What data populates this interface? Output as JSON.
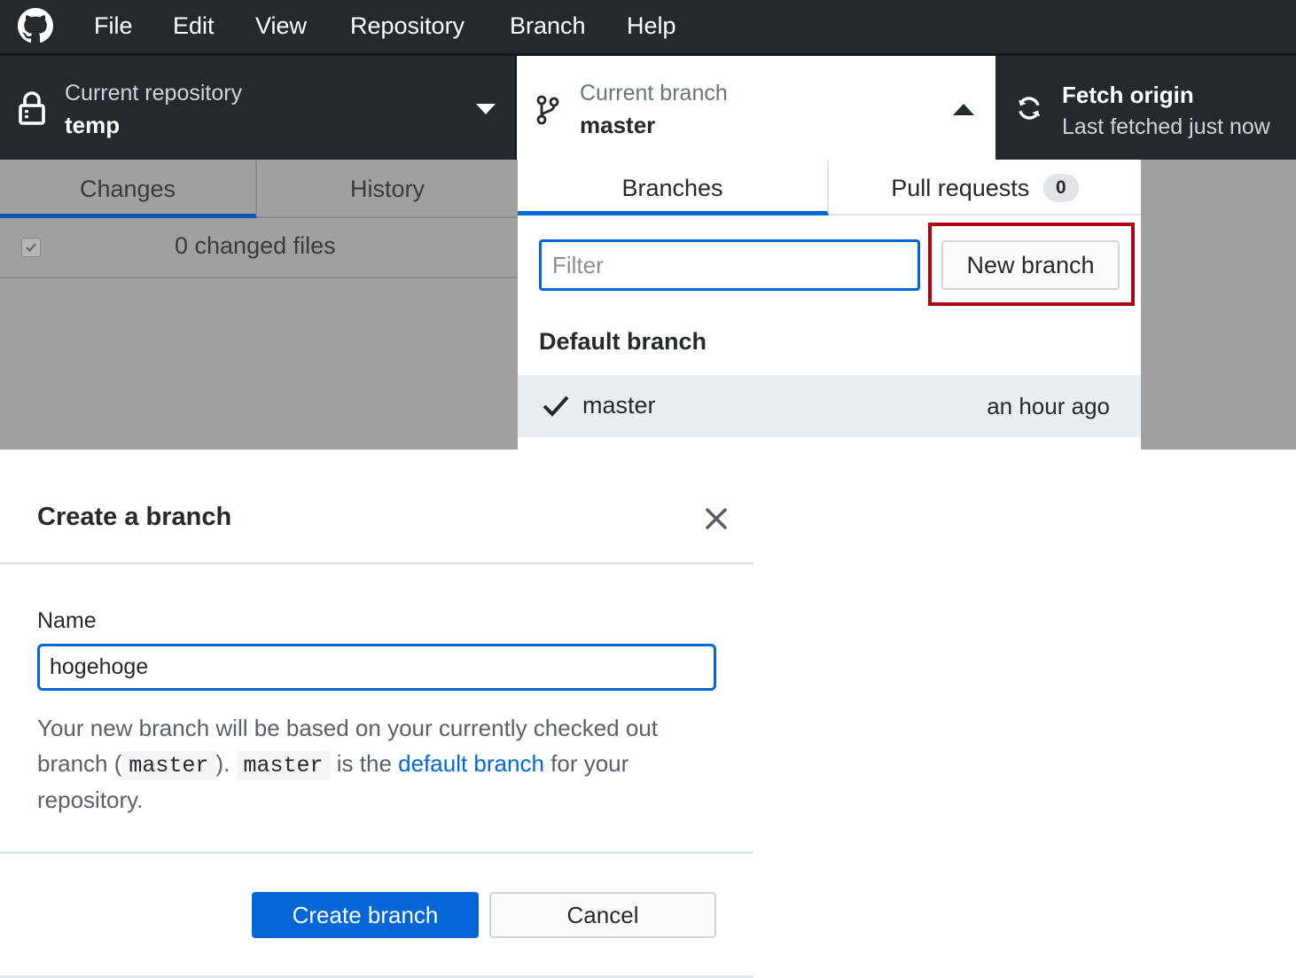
{
  "menubar": {
    "logo_icon": "github-logo-icon",
    "items": [
      "File",
      "Edit",
      "View",
      "Repository",
      "Branch",
      "Help"
    ]
  },
  "toolbar": {
    "repository": {
      "label": "Current repository",
      "value": "temp",
      "icon": "lock-icon"
    },
    "branch": {
      "label": "Current branch",
      "value": "master",
      "icon": "git-branch-icon"
    },
    "fetch": {
      "label": "Fetch origin",
      "subtitle": "Last fetched just now",
      "icon": "sync-icon"
    }
  },
  "left_panel": {
    "tabs": [
      "Changes",
      "History"
    ],
    "active_tab": "Changes",
    "changed_files": "0 changed files"
  },
  "branch_dropdown": {
    "tabs": {
      "branches": "Branches",
      "pull_requests": "Pull requests",
      "pull_request_count": "0"
    },
    "filter": {
      "placeholder": "Filter",
      "value": ""
    },
    "new_branch_label": "New branch",
    "section_title": "Default branch",
    "branches": [
      {
        "name": "master",
        "time": "an hour ago",
        "checked": true
      }
    ]
  },
  "dialog": {
    "title": "Create a branch",
    "name_label": "Name",
    "name_value": "hogehoge",
    "description": {
      "part1": "Your new branch will be based on your currently checked out branch (",
      "code1": "master",
      "part2": "). ",
      "code2": "master",
      "part3": " is the ",
      "link": "default branch",
      "part4": " for your repository."
    },
    "create_label": "Create branch",
    "cancel_label": "Cancel"
  },
  "colors": {
    "titlebar": "#24292e",
    "accent": "#0366d6",
    "highlight": "#b00014",
    "dim_overlay": "#a0a0a0"
  }
}
